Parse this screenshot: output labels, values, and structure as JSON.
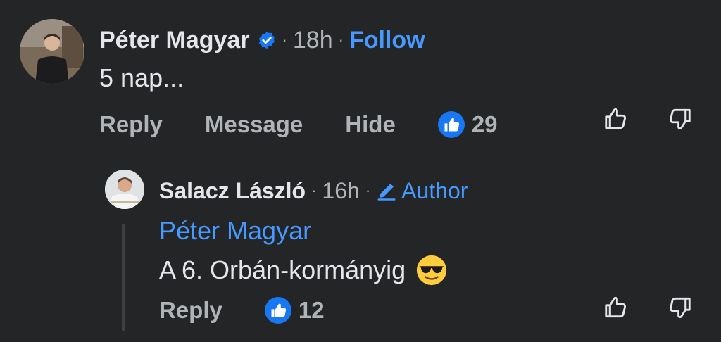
{
  "comment": {
    "author": "Péter Magyar",
    "time": "18h",
    "follow_label": "Follow",
    "text": "5 nap...",
    "actions": {
      "reply": "Reply",
      "message": "Message",
      "hide": "Hide"
    },
    "like_count": "29"
  },
  "reply": {
    "author": "Salacz László",
    "time": "16h",
    "author_badge": "Author",
    "mention": "Péter Magyar",
    "text": "A 6. Orbán-kormányig",
    "emoji": "smiling-face-with-sunglasses",
    "actions": {
      "reply": "Reply"
    },
    "like_count": "12"
  },
  "separator": "·",
  "colors": {
    "background": "#242526",
    "primary_text": "#e4e6eb",
    "secondary_text": "#b0b3b8",
    "link": "#4599ff",
    "like_badge": "#1877f2"
  }
}
